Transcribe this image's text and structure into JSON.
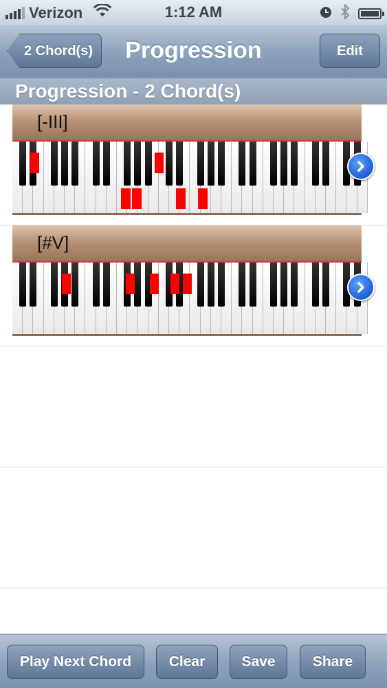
{
  "status_bar": {
    "carrier": "Verizon",
    "time": "1:12 AM",
    "signal_bars": 4,
    "battery_level": 0.85
  },
  "nav": {
    "back_label": "2 Chord(s)",
    "title": "Progression",
    "edit_label": "Edit"
  },
  "section": {
    "header": "Progression -  2 Chord(s)"
  },
  "chords": [
    {
      "name": "[-III]"
    },
    {
      "name": "[#V]"
    }
  ],
  "toolbar": {
    "play_next_label": "Play Next Chord",
    "clear_label": "Clear",
    "save_label": "Save",
    "share_label": "Share"
  },
  "colors": {
    "highlight": "#ff0000",
    "nav_blue": "#7890ad",
    "disclosure": "#1d5fd1"
  }
}
